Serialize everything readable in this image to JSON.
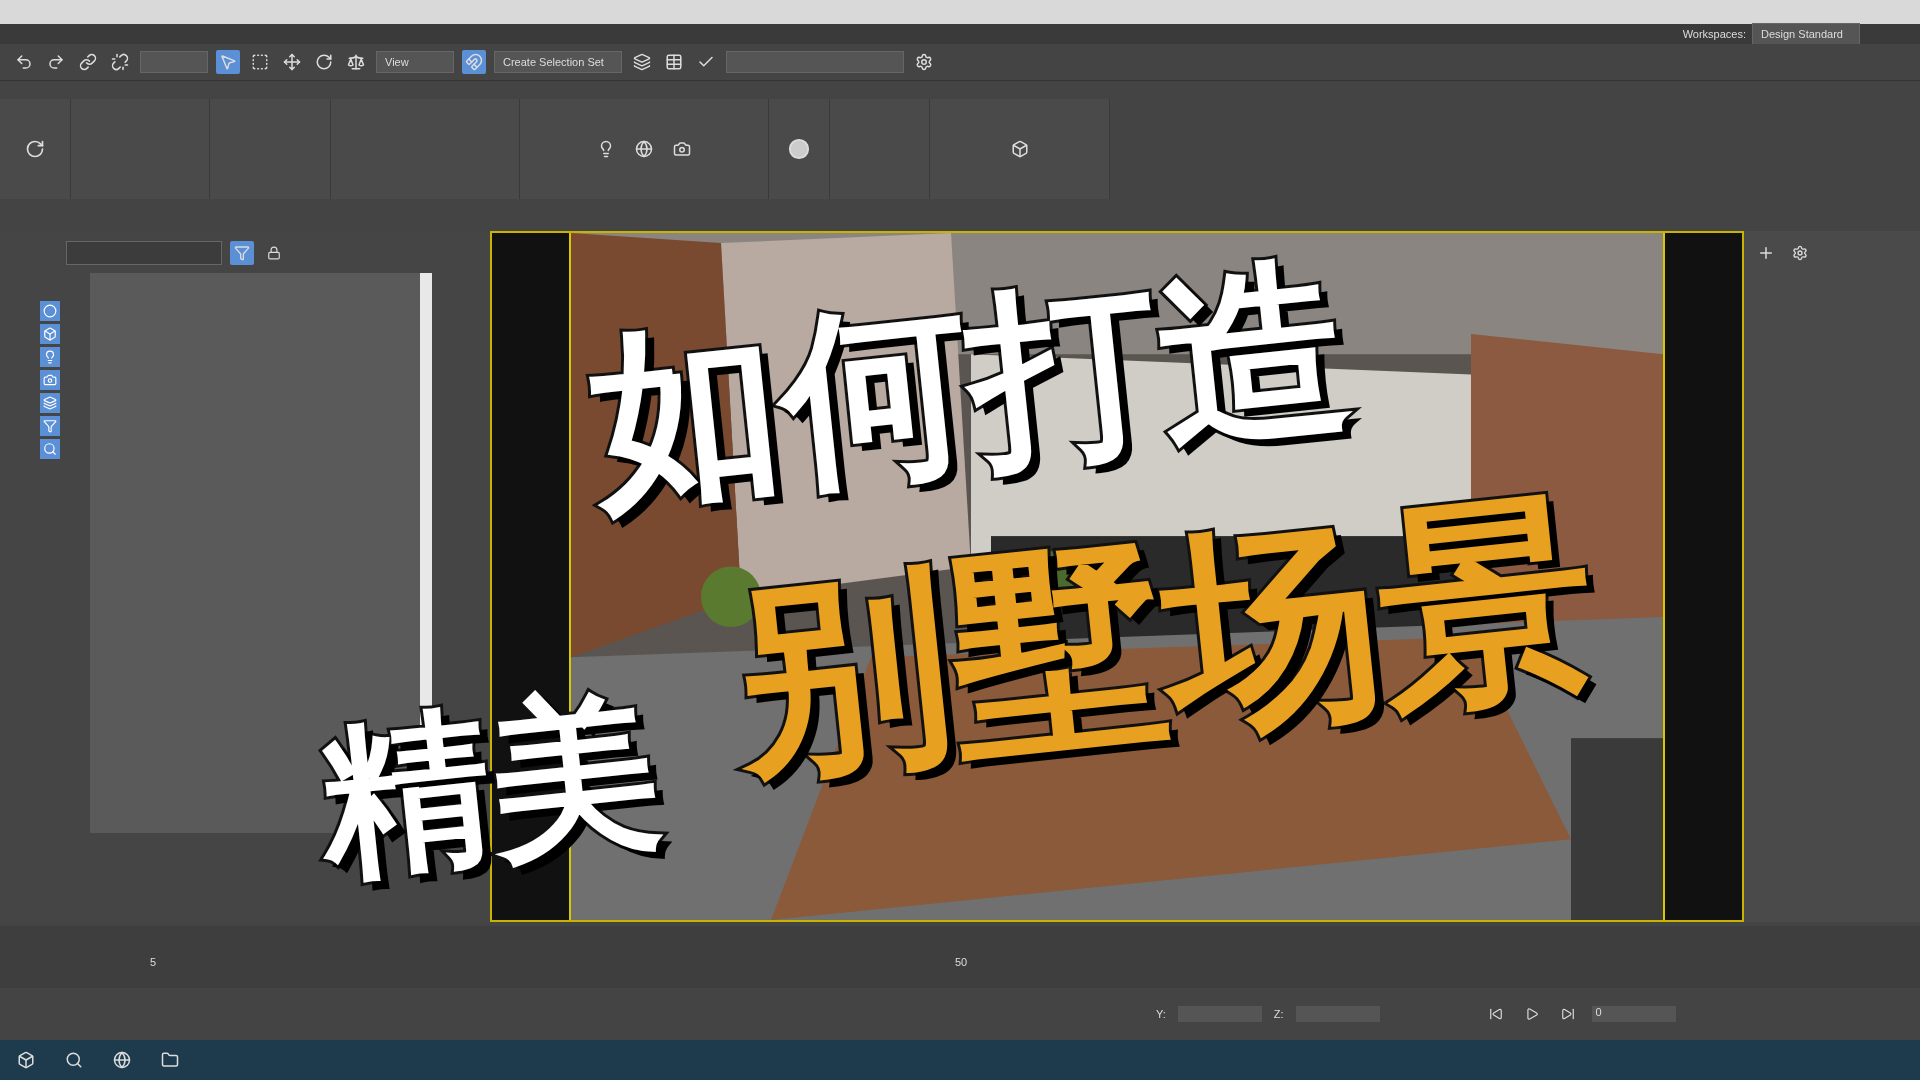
{
  "workspace": {
    "label": "Workspaces:",
    "value": "Design Standard"
  },
  "toolbar": {
    "view_dropdown": "View",
    "selection_set": "Create Selection Set"
  },
  "timeline": {
    "ticks": [
      "5",
      "50"
    ]
  },
  "status": {
    "y_label": "Y:",
    "z_label": "Z:",
    "frame": "0"
  },
  "overlay": {
    "line1": "如何打造",
    "line2_white": "精美",
    "line2_accent": "别墅场景"
  }
}
